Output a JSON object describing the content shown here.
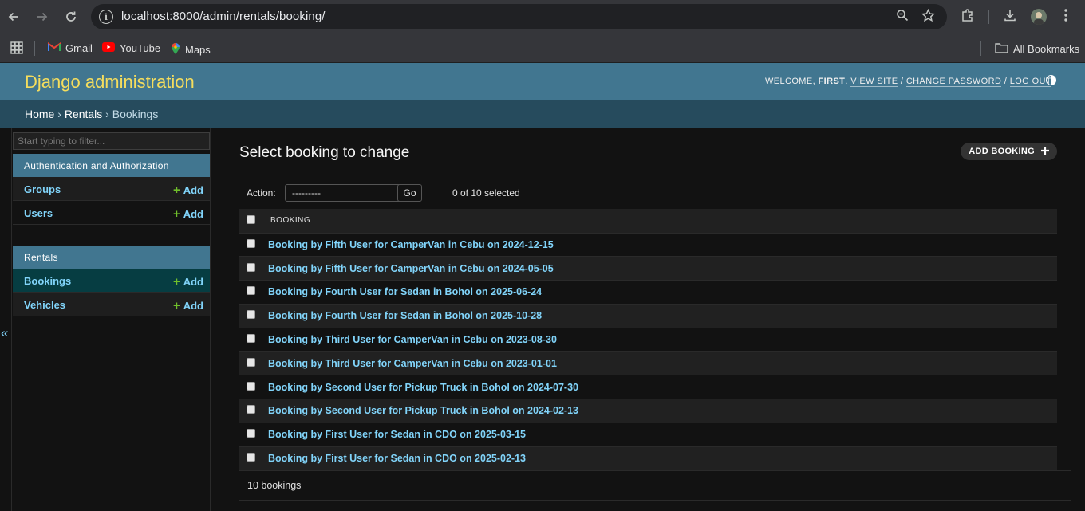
{
  "browser": {
    "url": "localhost:8000/admin/rentals/booking/",
    "bookmarks": [
      {
        "label": "Gmail",
        "icon": "gmail-icon"
      },
      {
        "label": "YouTube",
        "icon": "youtube-icon"
      },
      {
        "label": "Maps",
        "icon": "maps-icon"
      }
    ],
    "all_bookmarks": "All Bookmarks"
  },
  "header": {
    "site_name": "Django administration",
    "welcome": "Welcome,",
    "user": "First",
    "view_site": "View site",
    "change_password": "Change password",
    "log_out": "Log out"
  },
  "breadcrumbs": {
    "home": "Home",
    "app": "Rentals",
    "model": "Bookings",
    "sep": "›"
  },
  "sidebar": {
    "filter_placeholder": "Start typing to filter...",
    "collapse_glyph": "«",
    "apps": [
      {
        "caption": "Authentication and Authorization",
        "models": [
          {
            "name": "Groups",
            "add": "Add"
          },
          {
            "name": "Users",
            "add": "Add"
          }
        ]
      },
      {
        "caption": "Rentals",
        "models": [
          {
            "name": "Bookings",
            "add": "Add"
          },
          {
            "name": "Vehicles",
            "add": "Add"
          }
        ]
      }
    ]
  },
  "content": {
    "title": "Select booking to change",
    "add_button": "Add booking",
    "action_label": "Action:",
    "action_selected": "---------",
    "go_label": "Go",
    "selection_count": "0 of 10 selected",
    "column_header": "Booking",
    "rows": [
      "Booking by Fifth User for CamperVan in Cebu on 2024-12-15",
      "Booking by Fifth User for CamperVan in Cebu on 2024-05-05",
      "Booking by Fourth User for Sedan in Bohol on 2025-06-24",
      "Booking by Fourth User for Sedan in Bohol on 2025-10-28",
      "Booking by Third User for CamperVan in Cebu on 2023-08-30",
      "Booking by Third User for CamperVan in Cebu on 2023-01-01",
      "Booking by Second User for Pickup Truck in Bohol on 2024-07-30",
      "Booking by Second User for Pickup Truck in Bohol on 2024-02-13",
      "Booking by First User for Sedan in CDO on 2025-03-15",
      "Booking by First User for Sedan in CDO on 2025-02-13"
    ],
    "paginator": "10 bookings"
  },
  "colors": {
    "header_bg": "#417690",
    "branding": "#f5dd5d",
    "breadcrumbs_bg": "#264b5d",
    "link": "#81d4fa",
    "add_plus": "#70bf2b",
    "current_model_bg": "#063d42"
  }
}
